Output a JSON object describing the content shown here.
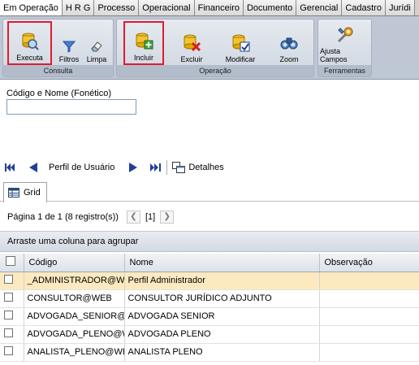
{
  "tabs": [
    {
      "label": "Em Operação"
    },
    {
      "label": "H R G"
    },
    {
      "label": "Processo"
    },
    {
      "label": "Operacional"
    },
    {
      "label": "Financeiro"
    },
    {
      "label": "Documento"
    },
    {
      "label": "Gerencial"
    },
    {
      "label": "Cadastro"
    },
    {
      "label": "Jurídi"
    }
  ],
  "ribbon": {
    "consulta": {
      "title": "Consulta",
      "executa": "Executa",
      "filtros": "Filtros",
      "limpa": "Limpa"
    },
    "operacao": {
      "title": "Operação",
      "incluir": "Incluir",
      "excluir": "Excluir",
      "modificar": "Modificar",
      "zoom": "Zoom"
    },
    "ferramentas": {
      "title": "Ferramentas",
      "ajusta": "Ajusta Campos"
    }
  },
  "search": {
    "label": "Código e Nome (Fonético)",
    "value": ""
  },
  "navigator": {
    "label": "Perfil de Usuário",
    "detalhes": "Detalhes"
  },
  "grid_tab": {
    "label": "Grid"
  },
  "pager": {
    "summary": "Página 1 de 1 (8 registro(s))",
    "current": "[1]"
  },
  "groupby": {
    "hint": "Arraste uma coluna para agrupar"
  },
  "table": {
    "columns": [
      "Código",
      "Nome",
      "Observação"
    ],
    "rows": [
      {
        "codigo": "_ADMINISTRADOR@WEB",
        "nome": "Perfil Administrador",
        "obs": ""
      },
      {
        "codigo": "CONSULTOR@WEB",
        "nome": "CONSULTOR JURÍDICO ADJUNTO",
        "obs": ""
      },
      {
        "codigo": "ADVOGADA_SENIOR@WEB",
        "nome": "ADVOGADA SENIOR",
        "obs": ""
      },
      {
        "codigo": "ADVOGADA_PLENO@WEB",
        "nome": "ADVOGADA PLENO",
        "obs": ""
      },
      {
        "codigo": "ANALISTA_PLENO@WEB",
        "nome": "ANALISTA PLENO",
        "obs": ""
      }
    ]
  },
  "colors": {
    "highlight": "#e01b2f",
    "selected_row": "#fde9bf"
  }
}
